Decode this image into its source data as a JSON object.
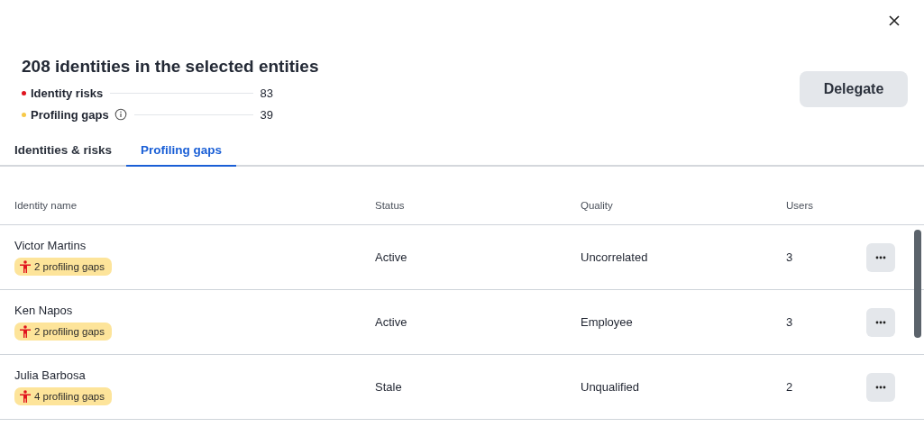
{
  "header": {
    "title": "208 identities in the selected entities",
    "summary": [
      {
        "label": "Identity risks",
        "count": "83",
        "color": "#e0141e",
        "info": false
      },
      {
        "label": "Profiling gaps",
        "count": "39",
        "color": "#f7c948",
        "info": true
      }
    ],
    "delegate_button": "Delegate"
  },
  "tabs": [
    {
      "label": "Identities & risks",
      "selected": false
    },
    {
      "label": "Profiling gaps",
      "selected": true
    }
  ],
  "table": {
    "columns": [
      "Identity name",
      "Status",
      "Quality",
      "Users"
    ],
    "rows": [
      {
        "name": "Victor Martins",
        "badge": "2 profiling gaps",
        "status": "Active",
        "quality": "Uncorrelated",
        "users": "3"
      },
      {
        "name": "Ken Napos",
        "badge": "2 profiling gaps",
        "status": "Active",
        "quality": "Employee",
        "users": "3"
      },
      {
        "name": "Julia Barbosa",
        "badge": "4 profiling gaps",
        "status": "Stale",
        "quality": "Unqualified",
        "users": "2"
      }
    ]
  }
}
